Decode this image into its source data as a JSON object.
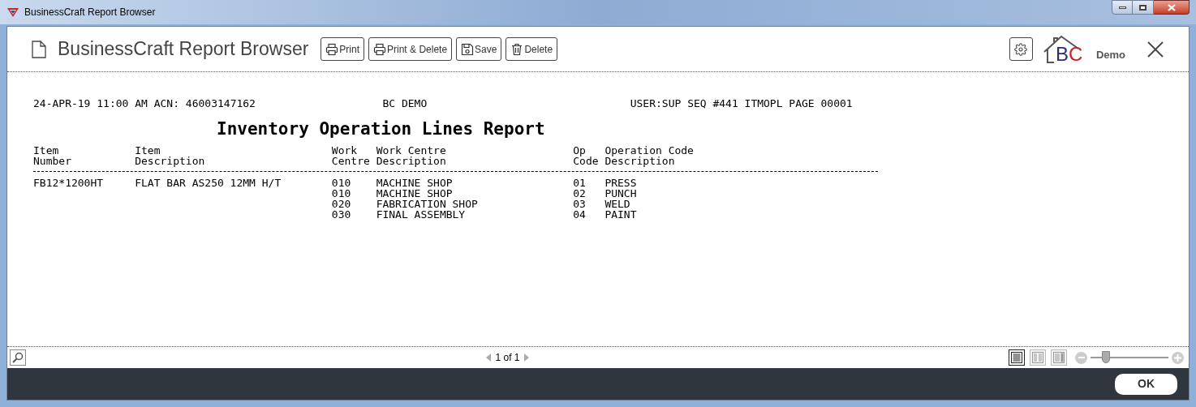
{
  "window": {
    "title": "BusinessCraft Report Browser"
  },
  "toolbar": {
    "title": "BusinessCraft Report Browser",
    "buttons": [
      {
        "kind": "print",
        "label": "Print"
      },
      {
        "kind": "print",
        "label": "Print & Delete"
      },
      {
        "kind": "save",
        "label": "Save"
      },
      {
        "kind": "delete",
        "label": "Delete"
      }
    ],
    "logo_text": [
      "B",
      "C"
    ],
    "logo_caption": "Demo"
  },
  "report": {
    "header": [
      "24-APR-19 11:00 AM ACN: 46003147162",
      "BC DEMO",
      "USER:SUP SEQ #441 ITMOPL PAGE 00001"
    ],
    "title": "Inventory Operation Lines Report",
    "columns": [
      {
        "lines": [
          "Item",
          "Number"
        ]
      },
      {
        "lines": [
          "Item",
          "Description"
        ]
      },
      {
        "lines": [
          "Work",
          "Centre"
        ]
      },
      {
        "lines": [
          "Work Centre",
          "Description"
        ]
      },
      {
        "lines": [
          "Op",
          "Code"
        ]
      },
      {
        "lines": [
          "Operation Code",
          "Description"
        ]
      }
    ],
    "items": [
      {
        "item_number": "FB12*1200HT",
        "item_description": "FLAT BAR AS250 12MM H/T",
        "operations": [
          {
            "work_centre": "010",
            "work_centre_description": "MACHINE SHOP",
            "op_code": "01",
            "operation_code_description": "PRESS"
          },
          {
            "work_centre": "010",
            "work_centre_description": "MACHINE SHOP",
            "op_code": "02",
            "operation_code_description": "PUNCH"
          },
          {
            "work_centre": "020",
            "work_centre_description": "FABRICATION SHOP",
            "op_code": "03",
            "operation_code_description": "WELD"
          },
          {
            "work_centre": "030",
            "work_centre_description": "FINAL ASSEMBLY",
            "op_code": "04",
            "operation_code_description": "PAINT"
          }
        ]
      }
    ]
  },
  "status_bar": {
    "page_indicator": "1 of 1",
    "view_modes": [
      {
        "selected": true
      },
      {
        "selected": false
      },
      {
        "selected": false
      }
    ],
    "zoom": {
      "level": 0.2
    }
  },
  "footer": {
    "buttons": [
      "OK"
    ]
  }
}
